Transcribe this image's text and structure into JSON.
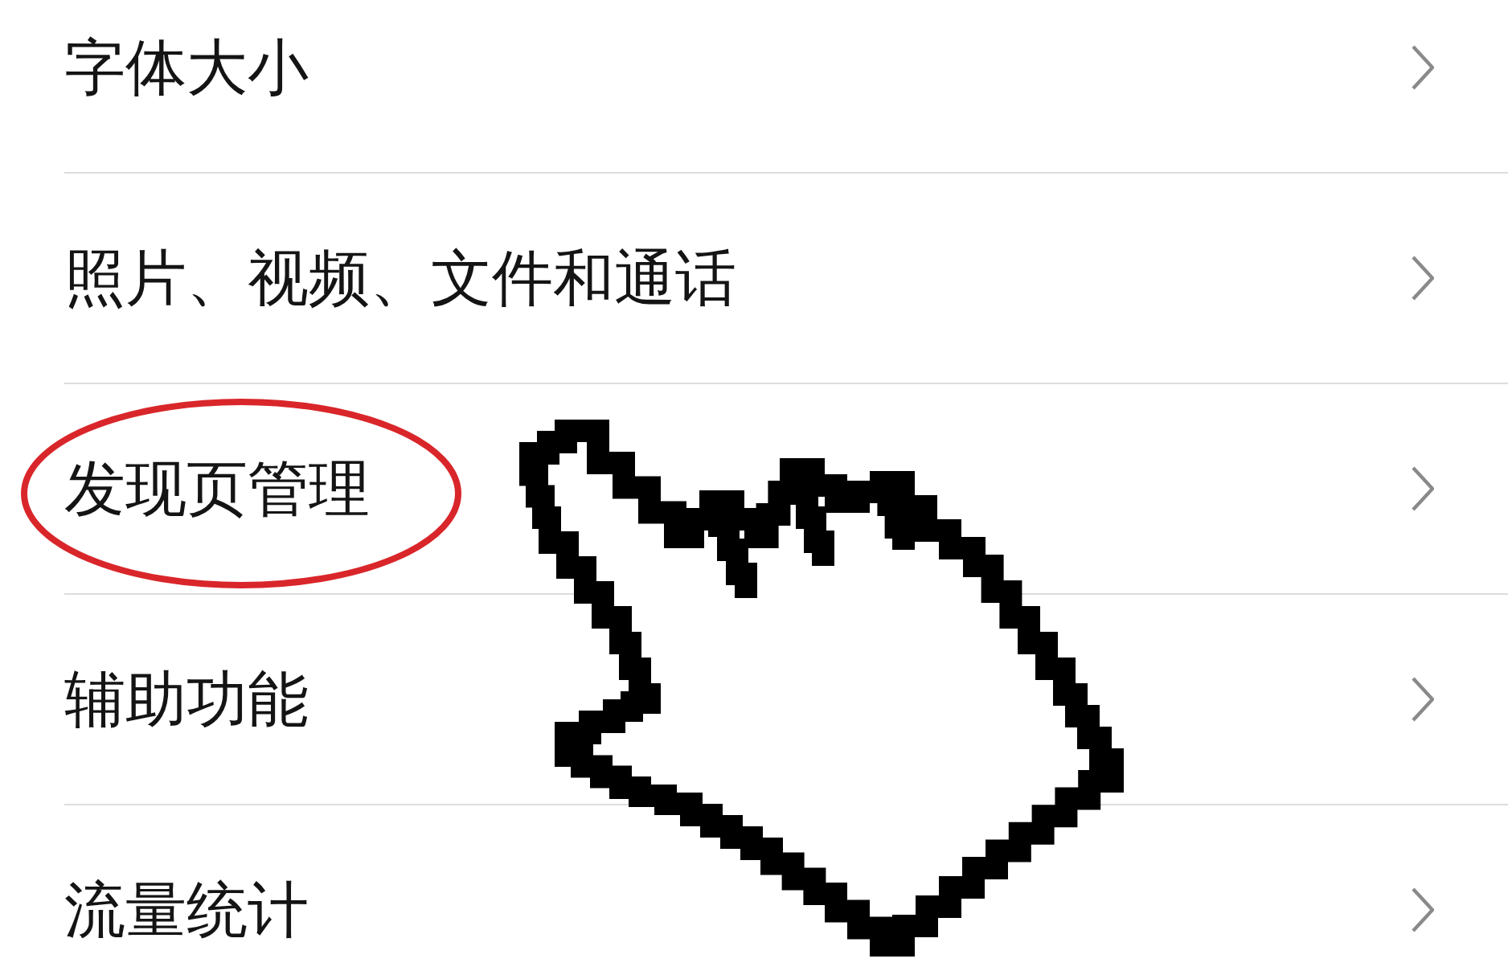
{
  "settings_list": [
    {
      "label": "字体大小",
      "circled": false
    },
    {
      "label": "照片、视频、文件和通话",
      "circled": false
    },
    {
      "label": "发现页管理",
      "circled": true
    },
    {
      "label": "辅助功能",
      "circled": false
    },
    {
      "label": "流量统计",
      "circled": false
    }
  ]
}
